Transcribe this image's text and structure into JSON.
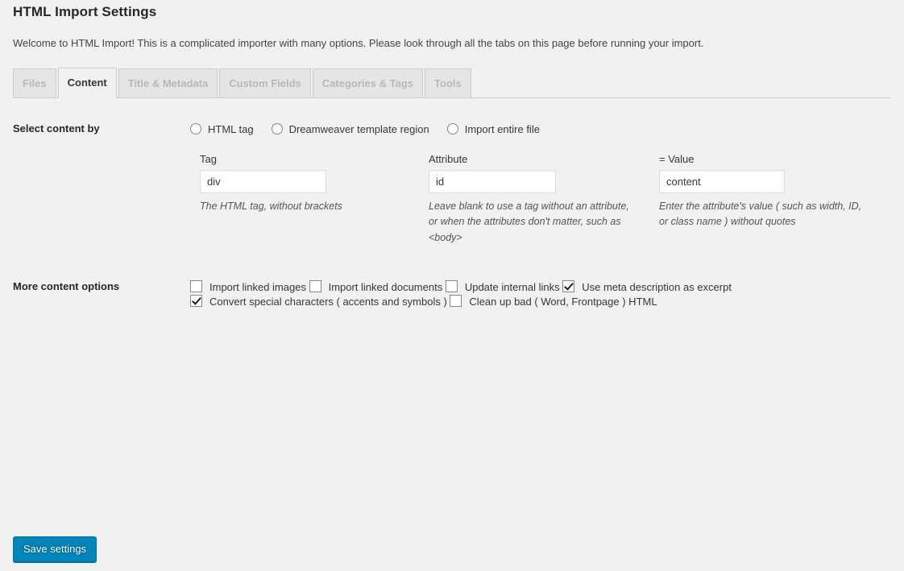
{
  "header": {
    "title": "HTML Import Settings",
    "intro": "Welcome to HTML Import! This is a complicated importer with many options. Please look through all the tabs on this page before running your import."
  },
  "tabs": [
    {
      "label": "Files",
      "active": false
    },
    {
      "label": "Content",
      "active": true
    },
    {
      "label": "Title & Metadata",
      "active": false
    },
    {
      "label": "Custom Fields",
      "active": false
    },
    {
      "label": "Categories & Tags",
      "active": false
    },
    {
      "label": "Tools",
      "active": false
    }
  ],
  "select_content_by": {
    "row_label": "Select content by",
    "options": [
      {
        "label": "HTML tag",
        "selected": false
      },
      {
        "label": "Dreamweaver template region",
        "selected": false
      },
      {
        "label": "Import entire file",
        "selected": false
      }
    ]
  },
  "fields": {
    "tag": {
      "label": "Tag",
      "value": "div",
      "placeholder": "",
      "help": "The HTML tag, without brackets"
    },
    "attribute": {
      "label": "Attribute",
      "value": "id",
      "placeholder": "",
      "help": "Leave blank to use a tag without an attribute, or when the attributes don't matter, such as <body>"
    },
    "value": {
      "label": "= Value",
      "value": "content",
      "placeholder": "",
      "help": "Enter the attribute's value ( such as width, ID, or class name ) without quotes"
    }
  },
  "more_content_options": {
    "row_label": "More content options",
    "checkboxes": [
      {
        "label": "Import linked images",
        "checked": false
      },
      {
        "label": "Import linked documents",
        "checked": false
      },
      {
        "label": "Update internal links",
        "checked": false
      },
      {
        "label": "Use meta description as excerpt",
        "checked": true
      },
      {
        "label": "Convert special characters ( accents and symbols )",
        "checked": true
      },
      {
        "label": "Clean up bad ( Word, Frontpage ) HTML",
        "checked": false
      }
    ]
  },
  "submit": {
    "save_label": "Save settings"
  },
  "colors": {
    "page_background": "#f1f1f1",
    "primary_button": "#0085ba",
    "primary_button_border": "#0073aa",
    "text": "#32373c",
    "tab_inactive_text": "#b4b9be"
  }
}
